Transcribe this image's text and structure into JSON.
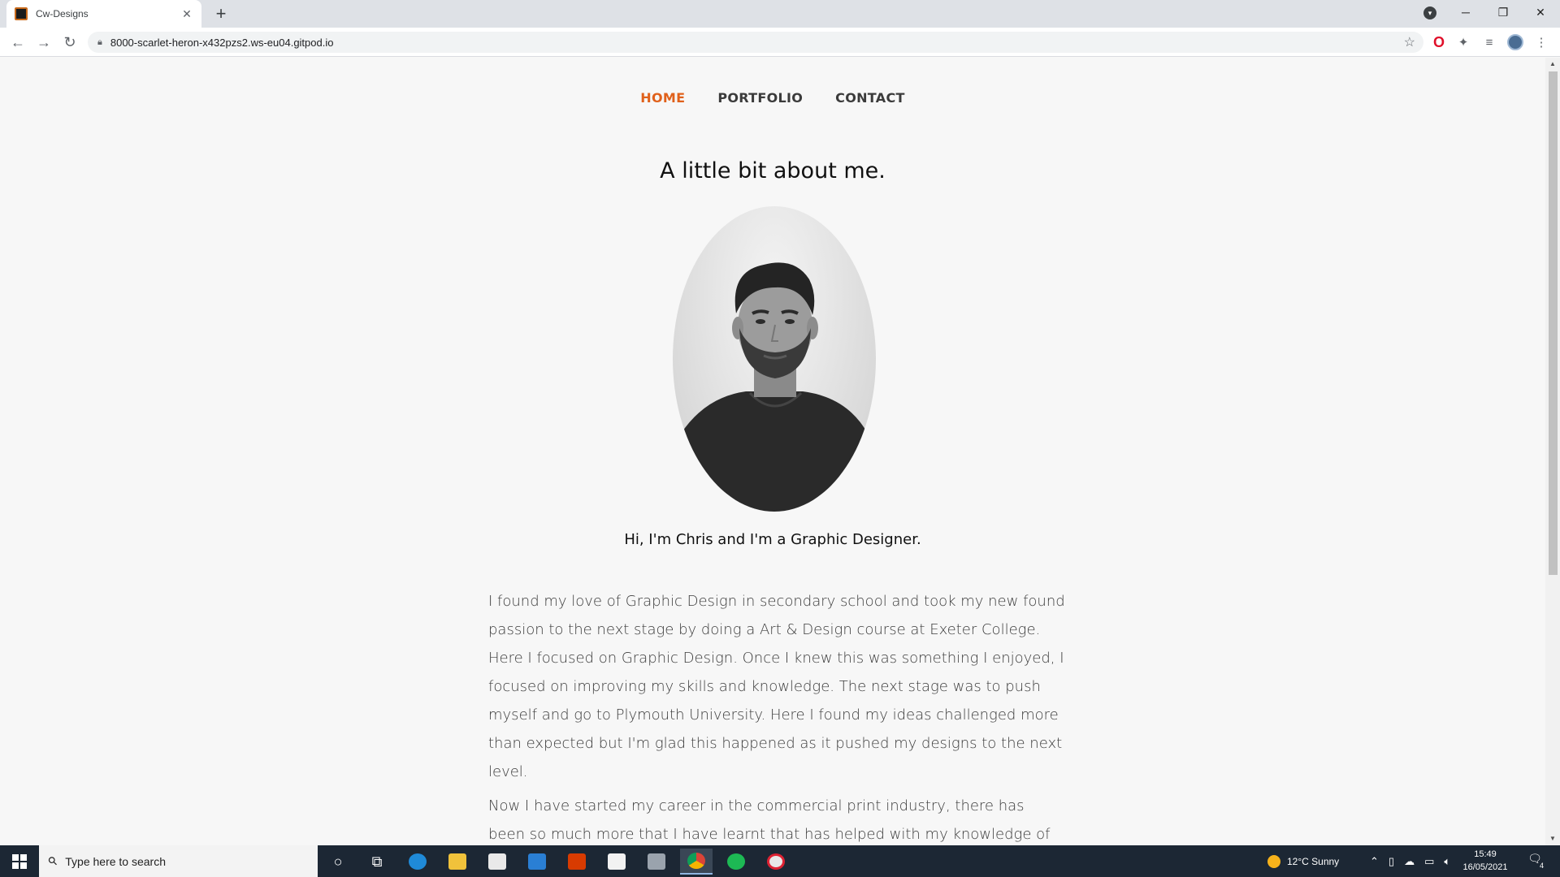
{
  "browser": {
    "tab_title": "Cw-Designs",
    "tab_close": "✕",
    "new_tab": "+",
    "url": "8000-scarlet-heron-x432pzs2.ws-eu04.gitpod.io",
    "back": "←",
    "forward": "→",
    "reload": "↻",
    "bookmark": "☆",
    "minimize": "─",
    "restore": "❐",
    "close": "✕",
    "menu": "⋮"
  },
  "page": {
    "nav": [
      {
        "label": "HOME",
        "active": true
      },
      {
        "label": "PORTFOLIO",
        "active": false
      },
      {
        "label": "CONTACT",
        "active": false
      }
    ],
    "heading": "A little bit about me.",
    "intro": "Hi, I'm Chris and I'm a Graphic Designer.",
    "bio_p1": "I found my love of Graphic Design in secondary school and took my new found passion to the next stage by doing a Art & Design course at Exeter College. Here I focused on Graphic Design. Once I knew this was something I enjoyed, I focused on improving my skills and knowledge. The next stage was to push myself and go to Plymouth University. Here I found my ideas challenged more than expected but I'm glad this happened as it pushed my designs to the next level.",
    "bio_p2": "Now I have started my career in the commercial print industry, there has been so much more that I have learnt that has helped with my knowledge of the design",
    "accent_color": "#e0611b"
  },
  "taskbar": {
    "search_placeholder": "Type here to search",
    "weather": "12°C  Sunny",
    "time": "15:49",
    "date": "16/05/2021",
    "notification_count": "4"
  }
}
